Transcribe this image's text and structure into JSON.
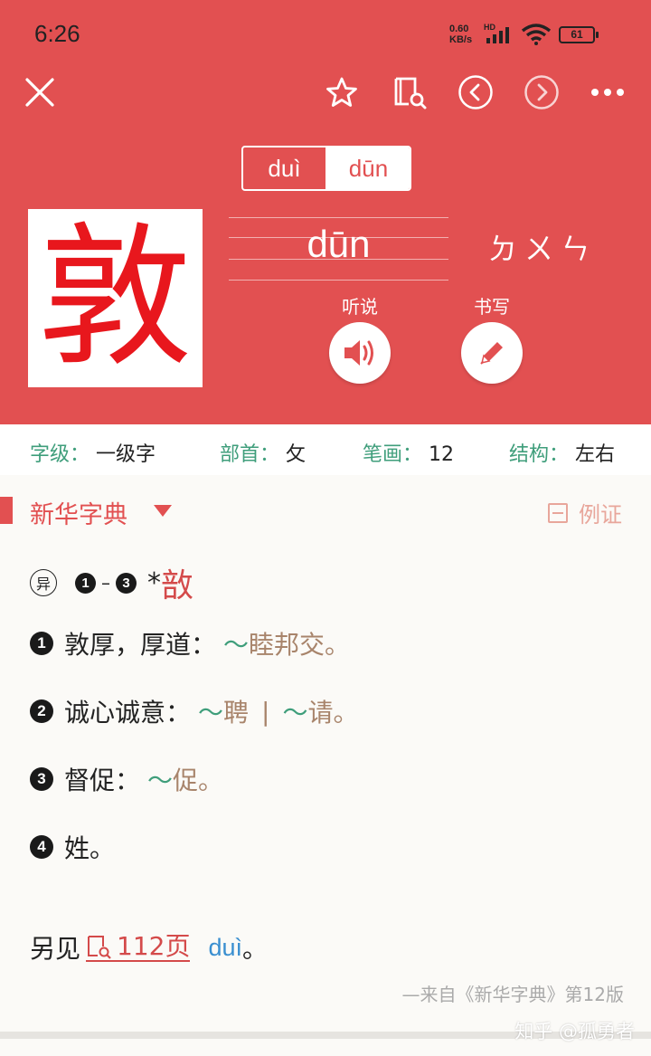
{
  "status": {
    "time": "6:26",
    "net_speed": "0.60",
    "net_unit": "KB/s",
    "hd": "HD",
    "battery": "61"
  },
  "toolbar": {
    "close_icon": "close-icon",
    "star_icon": "star-icon",
    "book_search_icon": "book-search-icon",
    "prev_icon": "chevron-left-icon",
    "next_icon": "chevron-right-icon",
    "more_icon": "more-icon"
  },
  "pronunciations": {
    "options": [
      "duì",
      "dūn"
    ],
    "selected": "dūn"
  },
  "character": "敦",
  "pinyin": "dūn",
  "zhuyin": "ㄉㄨㄣ",
  "actions": {
    "listen_label": "听说",
    "write_label": "书写"
  },
  "info": {
    "level_key": "字级",
    "level_val": "一级字",
    "radical_key": "部首",
    "radical_val": "攵",
    "strokes_key": "笔画",
    "strokes_val": "12",
    "structure_key": "结构",
    "structure_val": "左右"
  },
  "dictionary": {
    "title": "新华字典",
    "example_toggle": "例证",
    "variant_badge": "异",
    "variant_from": "1",
    "variant_to": "3",
    "variant_star": "*",
    "variant_char": "敨",
    "definitions": [
      {
        "num": "1",
        "text": "敦厚，厚道：",
        "examples": [
          "睦邦交。"
        ]
      },
      {
        "num": "2",
        "text": "诚心诚意：",
        "examples": [
          "聘",
          "请。"
        ]
      },
      {
        "num": "3",
        "text": "督促：",
        "examples": [
          "促。"
        ]
      },
      {
        "num": "4",
        "text": "姓。",
        "examples": []
      }
    ],
    "tilde": "～",
    "separator": "|",
    "see_also_label": "另见",
    "see_also_page": "112页",
    "see_also_pinyin": "duì",
    "see_also_end": "。",
    "source": "—来自《新华字典》第12版"
  },
  "colors": {
    "brand_red": "#e25051",
    "key_green": "#3f9e7b",
    "example_brown": "#a8846b",
    "link_blue": "#3a8fd0"
  },
  "watermark": "知乎 @孤勇者"
}
